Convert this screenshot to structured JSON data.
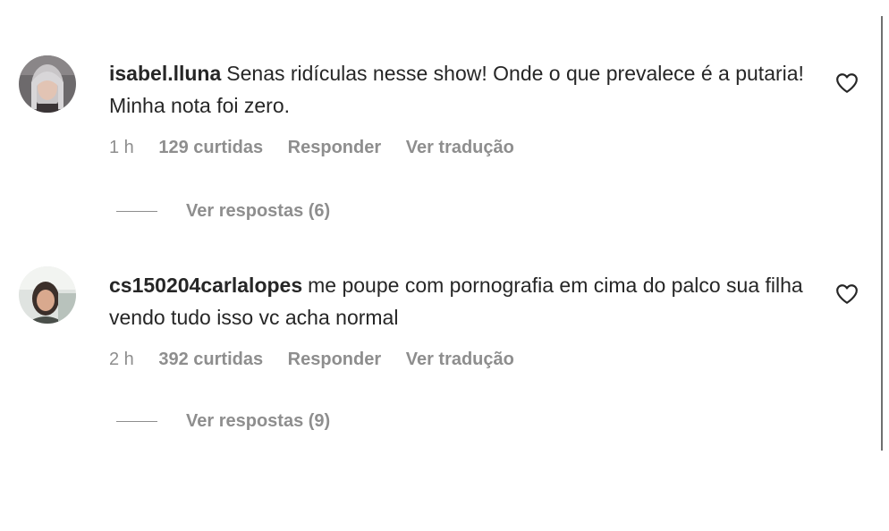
{
  "comments": [
    {
      "username": "isabel.lluna",
      "text": "Senas ridículas nesse show! Onde o que prevalece é a putaria! Minha nota foi zero.",
      "time": "1 h",
      "likes": "129 curtidas",
      "reply_label": "Responder",
      "translate_label": "Ver tradução",
      "view_replies": "Ver respostas (6)"
    },
    {
      "username": "cs150204carlalopes",
      "text": "me poupe com pornografia em cima do palco sua filha vendo tudo isso vc acha normal",
      "time": "2 h",
      "likes": "392 curtidas",
      "reply_label": "Responder",
      "translate_label": "Ver tradução",
      "view_replies": "Ver respostas (9)"
    }
  ],
  "icons": {
    "like": "heart-outline-icon"
  }
}
